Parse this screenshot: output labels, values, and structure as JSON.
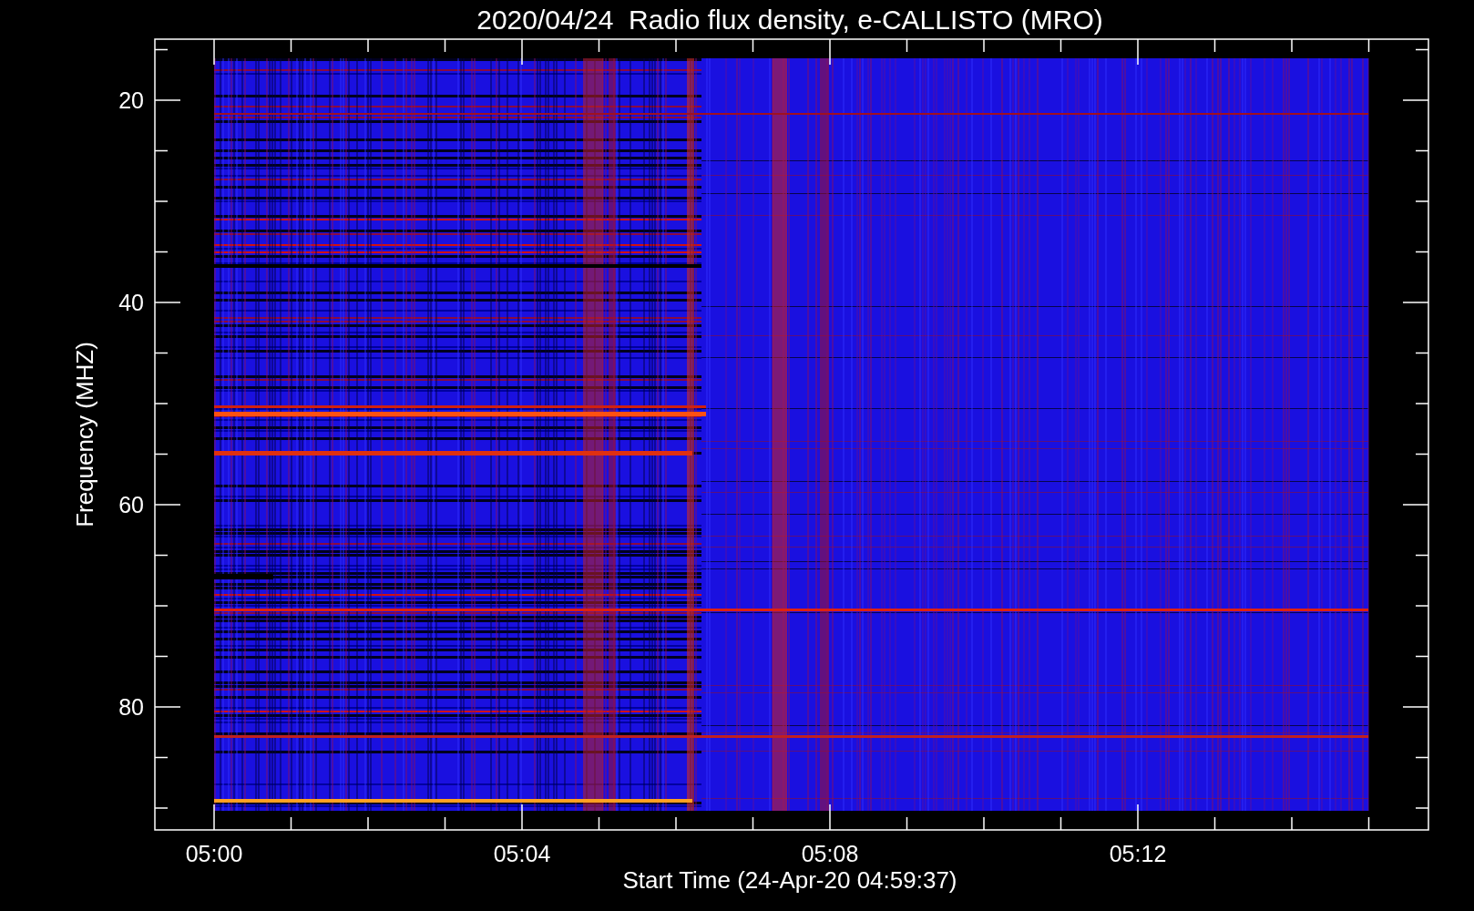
{
  "title": "2020/04/24  Radio flux density, e-CALLISTO (MRO)",
  "y_axis": {
    "label": "Frequency (MHZ)",
    "ticks": [
      "20",
      "40",
      "60",
      "80"
    ]
  },
  "x_axis": {
    "label": "Start Time (24-Apr-20 04:59:37)",
    "ticks": [
      "05:00",
      "05:04",
      "05:08",
      "05:12"
    ]
  }
}
